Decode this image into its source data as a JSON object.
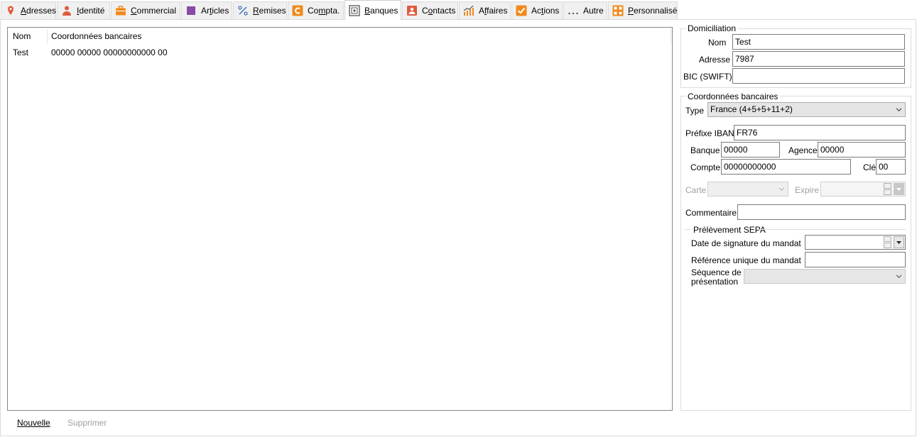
{
  "tabs": [
    {
      "key": "adresses",
      "label": "Adresses",
      "icon": "map-pin-icon",
      "color": "#e05a3c"
    },
    {
      "key": "identite",
      "label": "Identité",
      "icon": "person-icon",
      "color": "#e05a3c"
    },
    {
      "key": "commercial",
      "label": "Commercial",
      "icon": "briefcase-icon",
      "color": "#f08a1c"
    },
    {
      "key": "articles",
      "label": "Articles",
      "icon": "square-icon",
      "color": "#8a4aa8"
    },
    {
      "key": "remises",
      "label": "Remises",
      "icon": "percent-icon",
      "color": "#3a6fb5"
    },
    {
      "key": "compta",
      "label": "Compta.",
      "icon": "c-icon",
      "color": "#f08a1c"
    },
    {
      "key": "banques",
      "label": "Banques",
      "icon": "safe-icon",
      "color": "#555555"
    },
    {
      "key": "contacts",
      "label": "Contacts",
      "icon": "contact-card-icon",
      "color": "#e05a3c"
    },
    {
      "key": "affaires",
      "label": "Affaires",
      "icon": "chart-up-icon",
      "color": "#f08a1c"
    },
    {
      "key": "actions",
      "label": "Actions",
      "icon": "check-icon",
      "color": "#f08a1c"
    },
    {
      "key": "autre",
      "label": "Autre",
      "icon": "ellipsis-icon",
      "color": "#555555"
    },
    {
      "key": "personnalise",
      "label": "Personnalisé",
      "icon": "custom-grid-icon",
      "color": "#f08a1c"
    }
  ],
  "active_tab": "banques",
  "list": {
    "columns": [
      "Nom",
      "Coordonnées bancaires"
    ],
    "rows": [
      {
        "nom": "Test",
        "coordonnees": "00000 00000 00000000000 00"
      }
    ]
  },
  "buttons": {
    "new": "Nouvelle",
    "delete": "Supprimer"
  },
  "domiciliation": {
    "title": "Domiciliation",
    "nom_label": "Nom",
    "nom_value": "Test",
    "adresse_label": "Adresse",
    "adresse_value": "7987",
    "bic_label": "BIC (SWIFT)",
    "bic_value": ""
  },
  "coordonnees": {
    "title": "Coordonnées bancaires",
    "type_label": "Type",
    "type_value": "France (4+5+5+11+2)",
    "iban_label": "Préfixe IBAN",
    "iban_value": "FR76",
    "banque_label": "Banque",
    "banque_value": "00000",
    "agence_label": "Agence",
    "agence_value": "00000",
    "compte_label": "Compte",
    "compte_value": "00000000000",
    "cle_label": "Clé",
    "cle_value": "00",
    "carte_label": "Carte",
    "carte_value": "",
    "expire_label": "Expire",
    "expire_value": "",
    "commentaire_label": "Commentaire",
    "commentaire_value": ""
  },
  "sepa": {
    "title": "Prélèvement SEPA",
    "date_label": "Date de signature du mandat",
    "date_value": "",
    "ref_label": "Référence unique du mandat",
    "ref_value": "",
    "seq_label_1": "Séquence de",
    "seq_label_2": "présentation",
    "seq_value": ""
  }
}
